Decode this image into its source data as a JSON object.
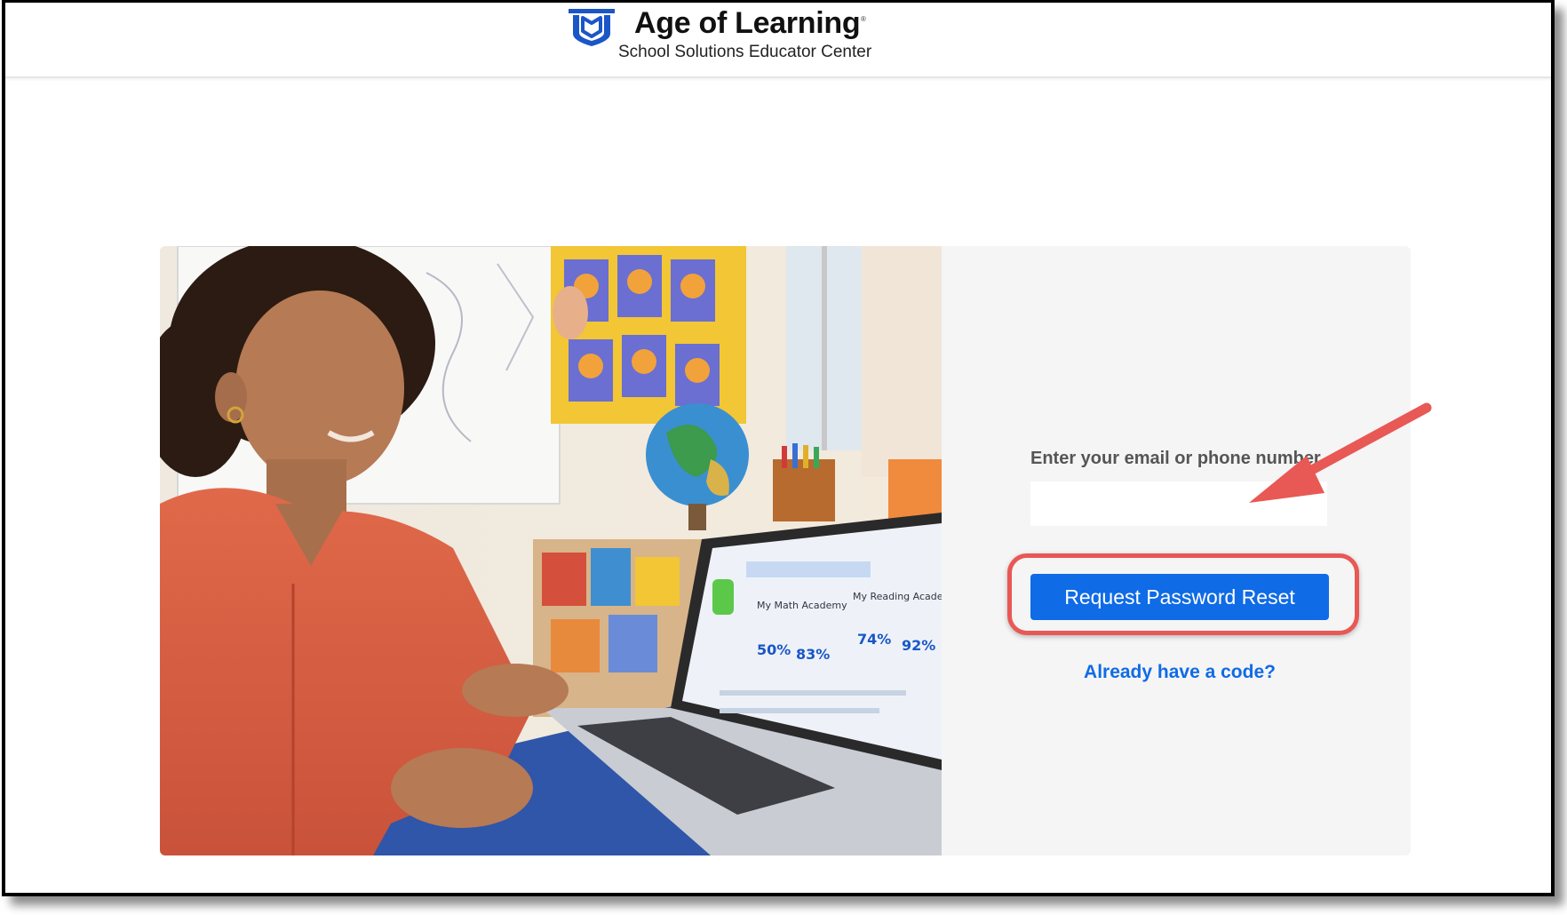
{
  "header": {
    "brand_name": "Age of Learning",
    "registered_mark": "®",
    "subtitle": "School Solutions Educator Center",
    "logo_icon": "open-book-shield-icon",
    "brand_color": "#1a56c8"
  },
  "form": {
    "label": "Enter your email or phone number",
    "input_value": "",
    "input_placeholder": "",
    "submit_label": "Request Password Reset",
    "code_link": "Already have a code?"
  },
  "laptop_screen": {
    "app_name": "My Math Academy",
    "app_name_2": "My Reading Academy",
    "stat_1": "50%",
    "stat_2": "83%",
    "stat_3": "74%",
    "stat_4": "92%"
  },
  "colors": {
    "primary": "#0f6be6",
    "annotation": "#e85855",
    "panel": "#f5f5f5"
  }
}
